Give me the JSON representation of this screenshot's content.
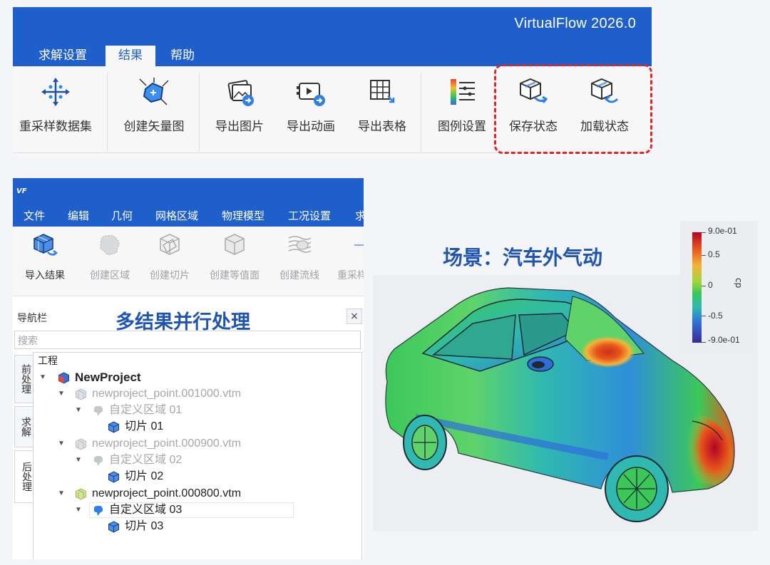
{
  "ribbon": {
    "app_title": "VirtualFlow  2026.0",
    "tabs": [
      {
        "label": "求解设置",
        "active": false
      },
      {
        "label": "结果",
        "active": true
      },
      {
        "label": "帮助",
        "active": false
      }
    ],
    "buttons": [
      {
        "label": "重采样数据集",
        "icon": "resample-icon"
      },
      {
        "label": "创建矢量图",
        "icon": "vector-plot-icon"
      },
      {
        "label": "导出图片",
        "icon": "export-image-icon"
      },
      {
        "label": "导出动画",
        "icon": "export-animation-icon"
      },
      {
        "label": "导出表格",
        "icon": "export-table-icon"
      },
      {
        "label": "图例设置",
        "icon": "legend-settings-icon"
      },
      {
        "label": "保存状态",
        "icon": "save-state-icon"
      },
      {
        "label": "加载状态",
        "icon": "load-state-icon"
      }
    ],
    "highlight_color": "#e3242b",
    "accent": "#1f5fcc"
  },
  "app_window": {
    "logo": "VF",
    "menu": [
      "文件",
      "编辑",
      "几何",
      "网格区域",
      "物理模型",
      "工况设置",
      "求"
    ],
    "toolbar": [
      {
        "label": "导入结果",
        "enabled": true,
        "icon": "import-results-icon"
      },
      {
        "label": "创建区域",
        "enabled": false,
        "icon": "create-region-icon"
      },
      {
        "label": "创建切片",
        "enabled": false,
        "icon": "create-slice-icon"
      },
      {
        "label": "创建等值面",
        "enabled": false,
        "icon": "create-isosurface-icon"
      },
      {
        "label": "创建流线",
        "enabled": false,
        "icon": "create-streamline-icon"
      },
      {
        "label": "重采样",
        "enabled": false,
        "icon": "resample-icon"
      }
    ],
    "navigator": {
      "title": "导航栏",
      "close": "×",
      "search_placeholder": "搜索",
      "side_tabs": [
        "前处理",
        "求解",
        "后处理"
      ],
      "tree": {
        "root_label": "工程",
        "project": "NewProject",
        "items": [
          {
            "file": "newproject_point.001000.vtm",
            "region": "自定义区域 01",
            "slice": "切片 01",
            "active": false
          },
          {
            "file": "newproject_point.000900.vtm",
            "region": "自定义区域 02",
            "slice": "切片 02",
            "active": false
          },
          {
            "file": "newproject_point.000800.vtm",
            "region": "自定义区域 03",
            "slice": "切片 03",
            "active": true
          }
        ]
      }
    }
  },
  "overlay_title": "多结果并行处理",
  "scene": {
    "title": "场景：汽车外气动",
    "colorbar": {
      "variable": "cp",
      "labels": [
        "9.0e-01",
        "0.5",
        "0",
        "-0.5",
        "-9.0e-01"
      ],
      "colors": [
        "#b40426",
        "#e8561a",
        "#f3b43a",
        "#9ed638",
        "#3cc859",
        "#2fb9b0",
        "#2f6dd8",
        "#3b2a94"
      ]
    }
  }
}
